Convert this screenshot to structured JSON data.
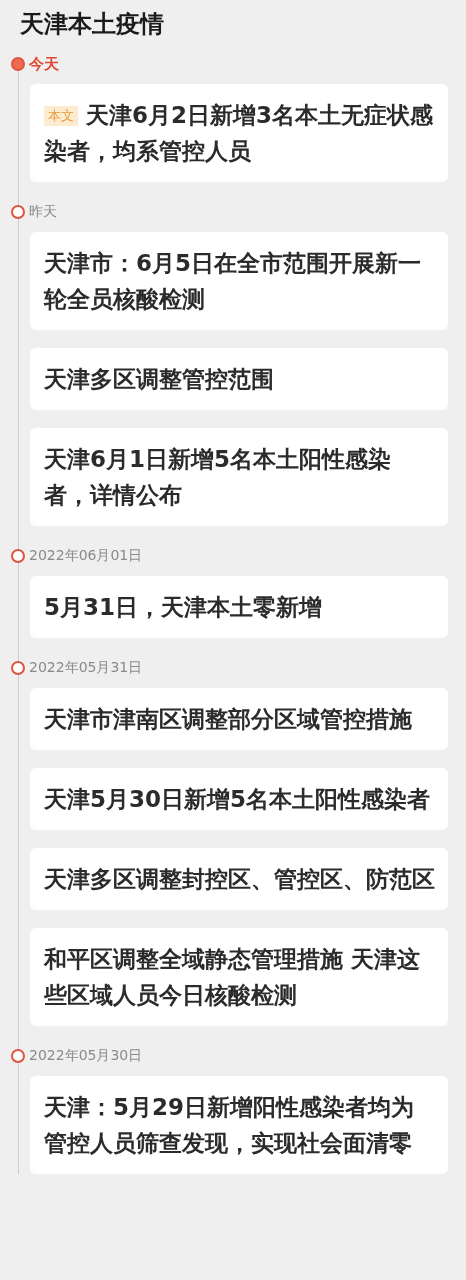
{
  "title": "天津本土疫情",
  "groups": [
    {
      "label": "今天",
      "current": true,
      "items": [
        {
          "tag": "本文",
          "text": "天津6月2日新增3名本土无症状感染者，均系管控人员"
        }
      ]
    },
    {
      "label": "昨天",
      "current": false,
      "items": [
        {
          "text": "天津市：6月5日在全市范围开展新一轮全员核酸检测"
        },
        {
          "text": "天津多区调整管控范围"
        },
        {
          "text": "天津6月1日新增5名本土阳性感染者，详情公布"
        }
      ]
    },
    {
      "label": "2022年06月01日",
      "current": false,
      "items": [
        {
          "text": "5月31日，天津本土零新增"
        }
      ]
    },
    {
      "label": "2022年05月31日",
      "current": false,
      "items": [
        {
          "text": "天津市津南区调整部分区域管控措施"
        },
        {
          "text": "天津5月30日新增5名本土阳性感染者"
        },
        {
          "text": "天津多区调整封控区、管控区、防范区"
        },
        {
          "text": "和平区调整全域静态管理措施 天津这些区域人员今日核酸检测"
        }
      ]
    },
    {
      "label": "2022年05月30日",
      "current": false,
      "items": [
        {
          "text": "天津：5月29日新增阳性感染者均为管控人员筛查发现，实现社会面清零"
        }
      ]
    }
  ]
}
